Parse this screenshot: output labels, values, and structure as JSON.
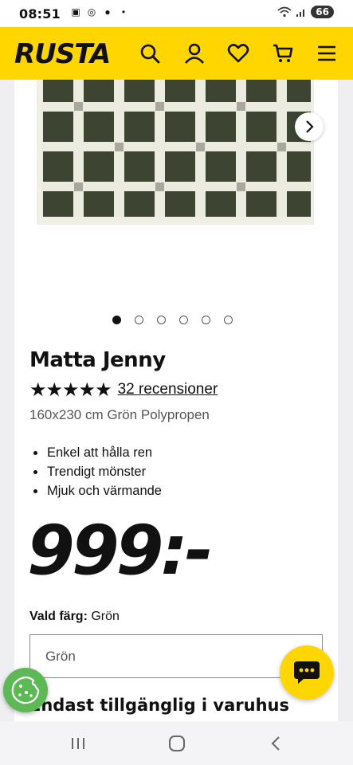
{
  "status_bar": {
    "time": "08:51",
    "battery": "66"
  },
  "header": {
    "logo": "RUSTA",
    "icons": [
      "search-icon",
      "user-icon",
      "heart-icon",
      "cart-icon",
      "menu-icon"
    ],
    "accent_color": "#ffd600"
  },
  "gallery": {
    "image_count": 6,
    "active_index": 0
  },
  "product": {
    "title": "Matta Jenny",
    "stars": "★★★★★",
    "rating": 5,
    "reviews": "32 recensioner",
    "subtitle": "160x230 cm Grön Polypropen",
    "features": [
      "Enkel att hålla ren",
      "Trendigt mönster",
      "Mjuk och värmande"
    ],
    "price": "999:-",
    "color_label": "Vald färg:",
    "color_value": "Grön",
    "color_select_value": "Grön",
    "availability": "Endast tillgänglig i varuhus"
  },
  "colors": {
    "rug_green": "#3d4532",
    "rug_cream": "#ecebdf",
    "rug_grey": "#a8a89c",
    "cookie_green": "#5db856"
  }
}
